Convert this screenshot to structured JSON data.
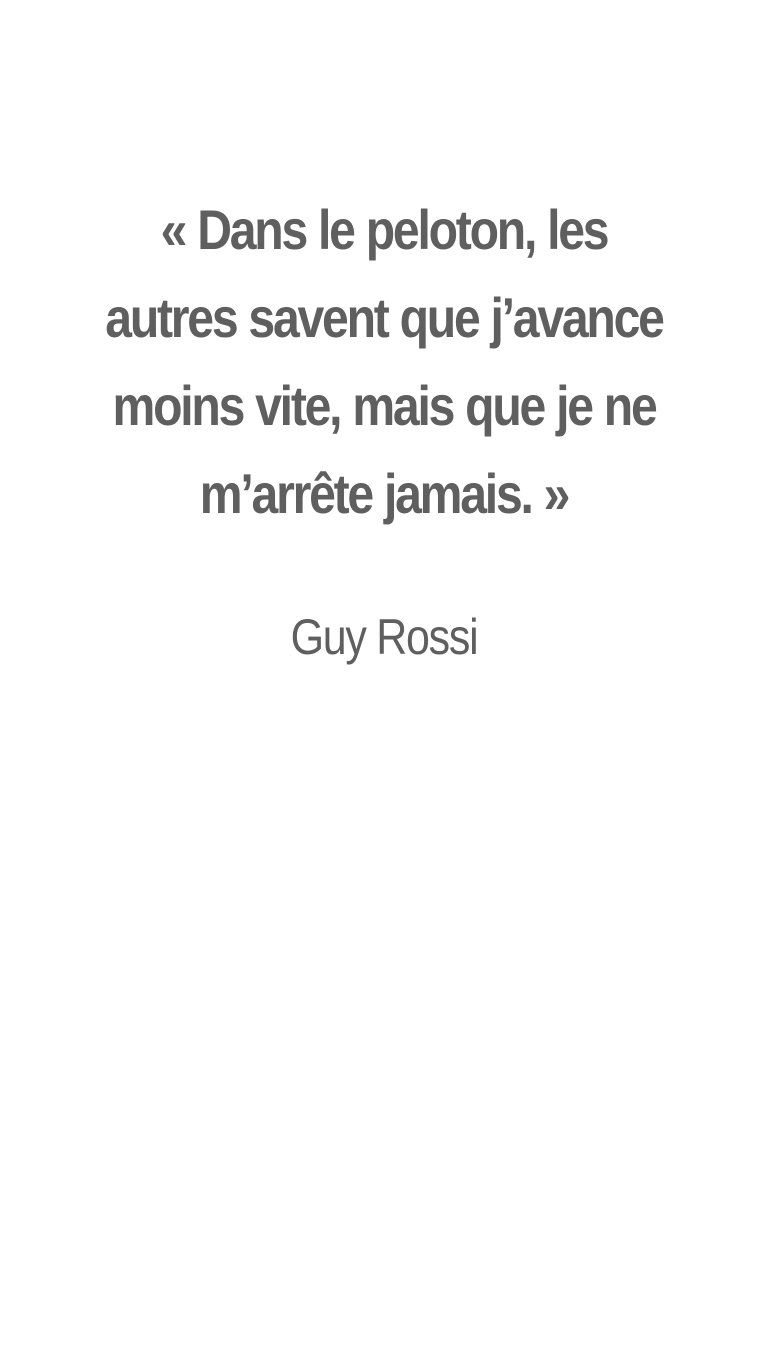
{
  "quote": {
    "lines": [
      "« Dans le peloton, les",
      "autres savent que j’avance",
      "moins vite, mais que je ne",
      "m’arrête jamais. »"
    ]
  },
  "author": {
    "name": "Guy Rossi"
  },
  "colors": {
    "background": "#ffffff",
    "text": "#5f5f5f"
  }
}
